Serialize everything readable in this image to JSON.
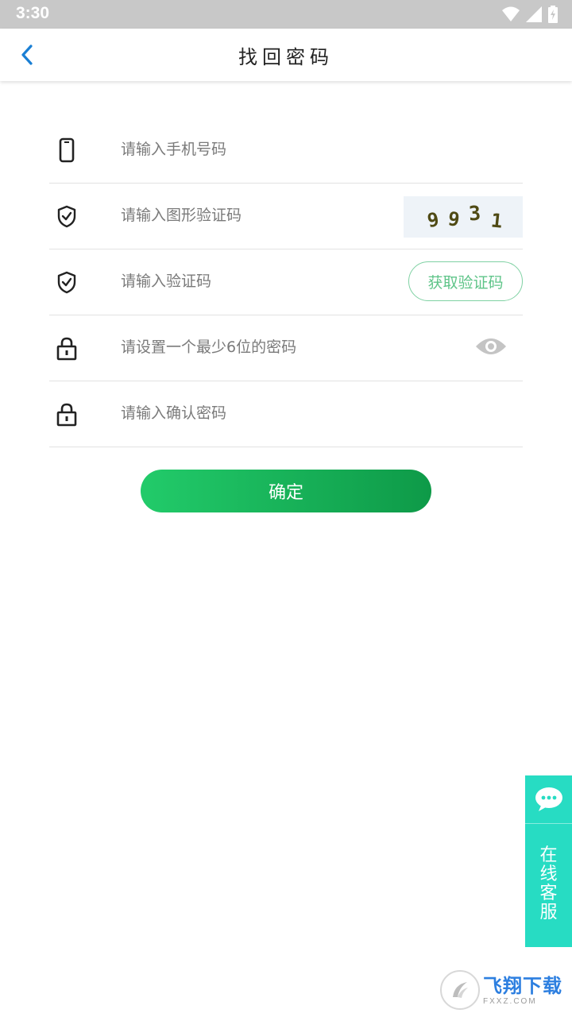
{
  "status_bar": {
    "time": "3:30"
  },
  "header": {
    "title": "找回密码"
  },
  "form": {
    "phone_placeholder": "请输入手机号码",
    "image_code_placeholder": "请输入图形验证码",
    "captcha_digits": [
      "9",
      "9",
      "3",
      "1"
    ],
    "sms_code_placeholder": "请输入验证码",
    "get_code_label": "获取验证码",
    "password_placeholder": "请设置一个最少6位的密码",
    "confirm_password_placeholder": "请输入确认密码"
  },
  "confirm_button_label": "确定",
  "customer_service": {
    "label": "在线客服"
  },
  "watermark": {
    "main": "飞翔下载",
    "sub": "FXXZ.COM"
  },
  "colors": {
    "accent_green": "#13b35a",
    "outline_green": "#5ec488",
    "back_arrow_blue": "#1a7fd4",
    "service_teal": "#27dcc3"
  }
}
